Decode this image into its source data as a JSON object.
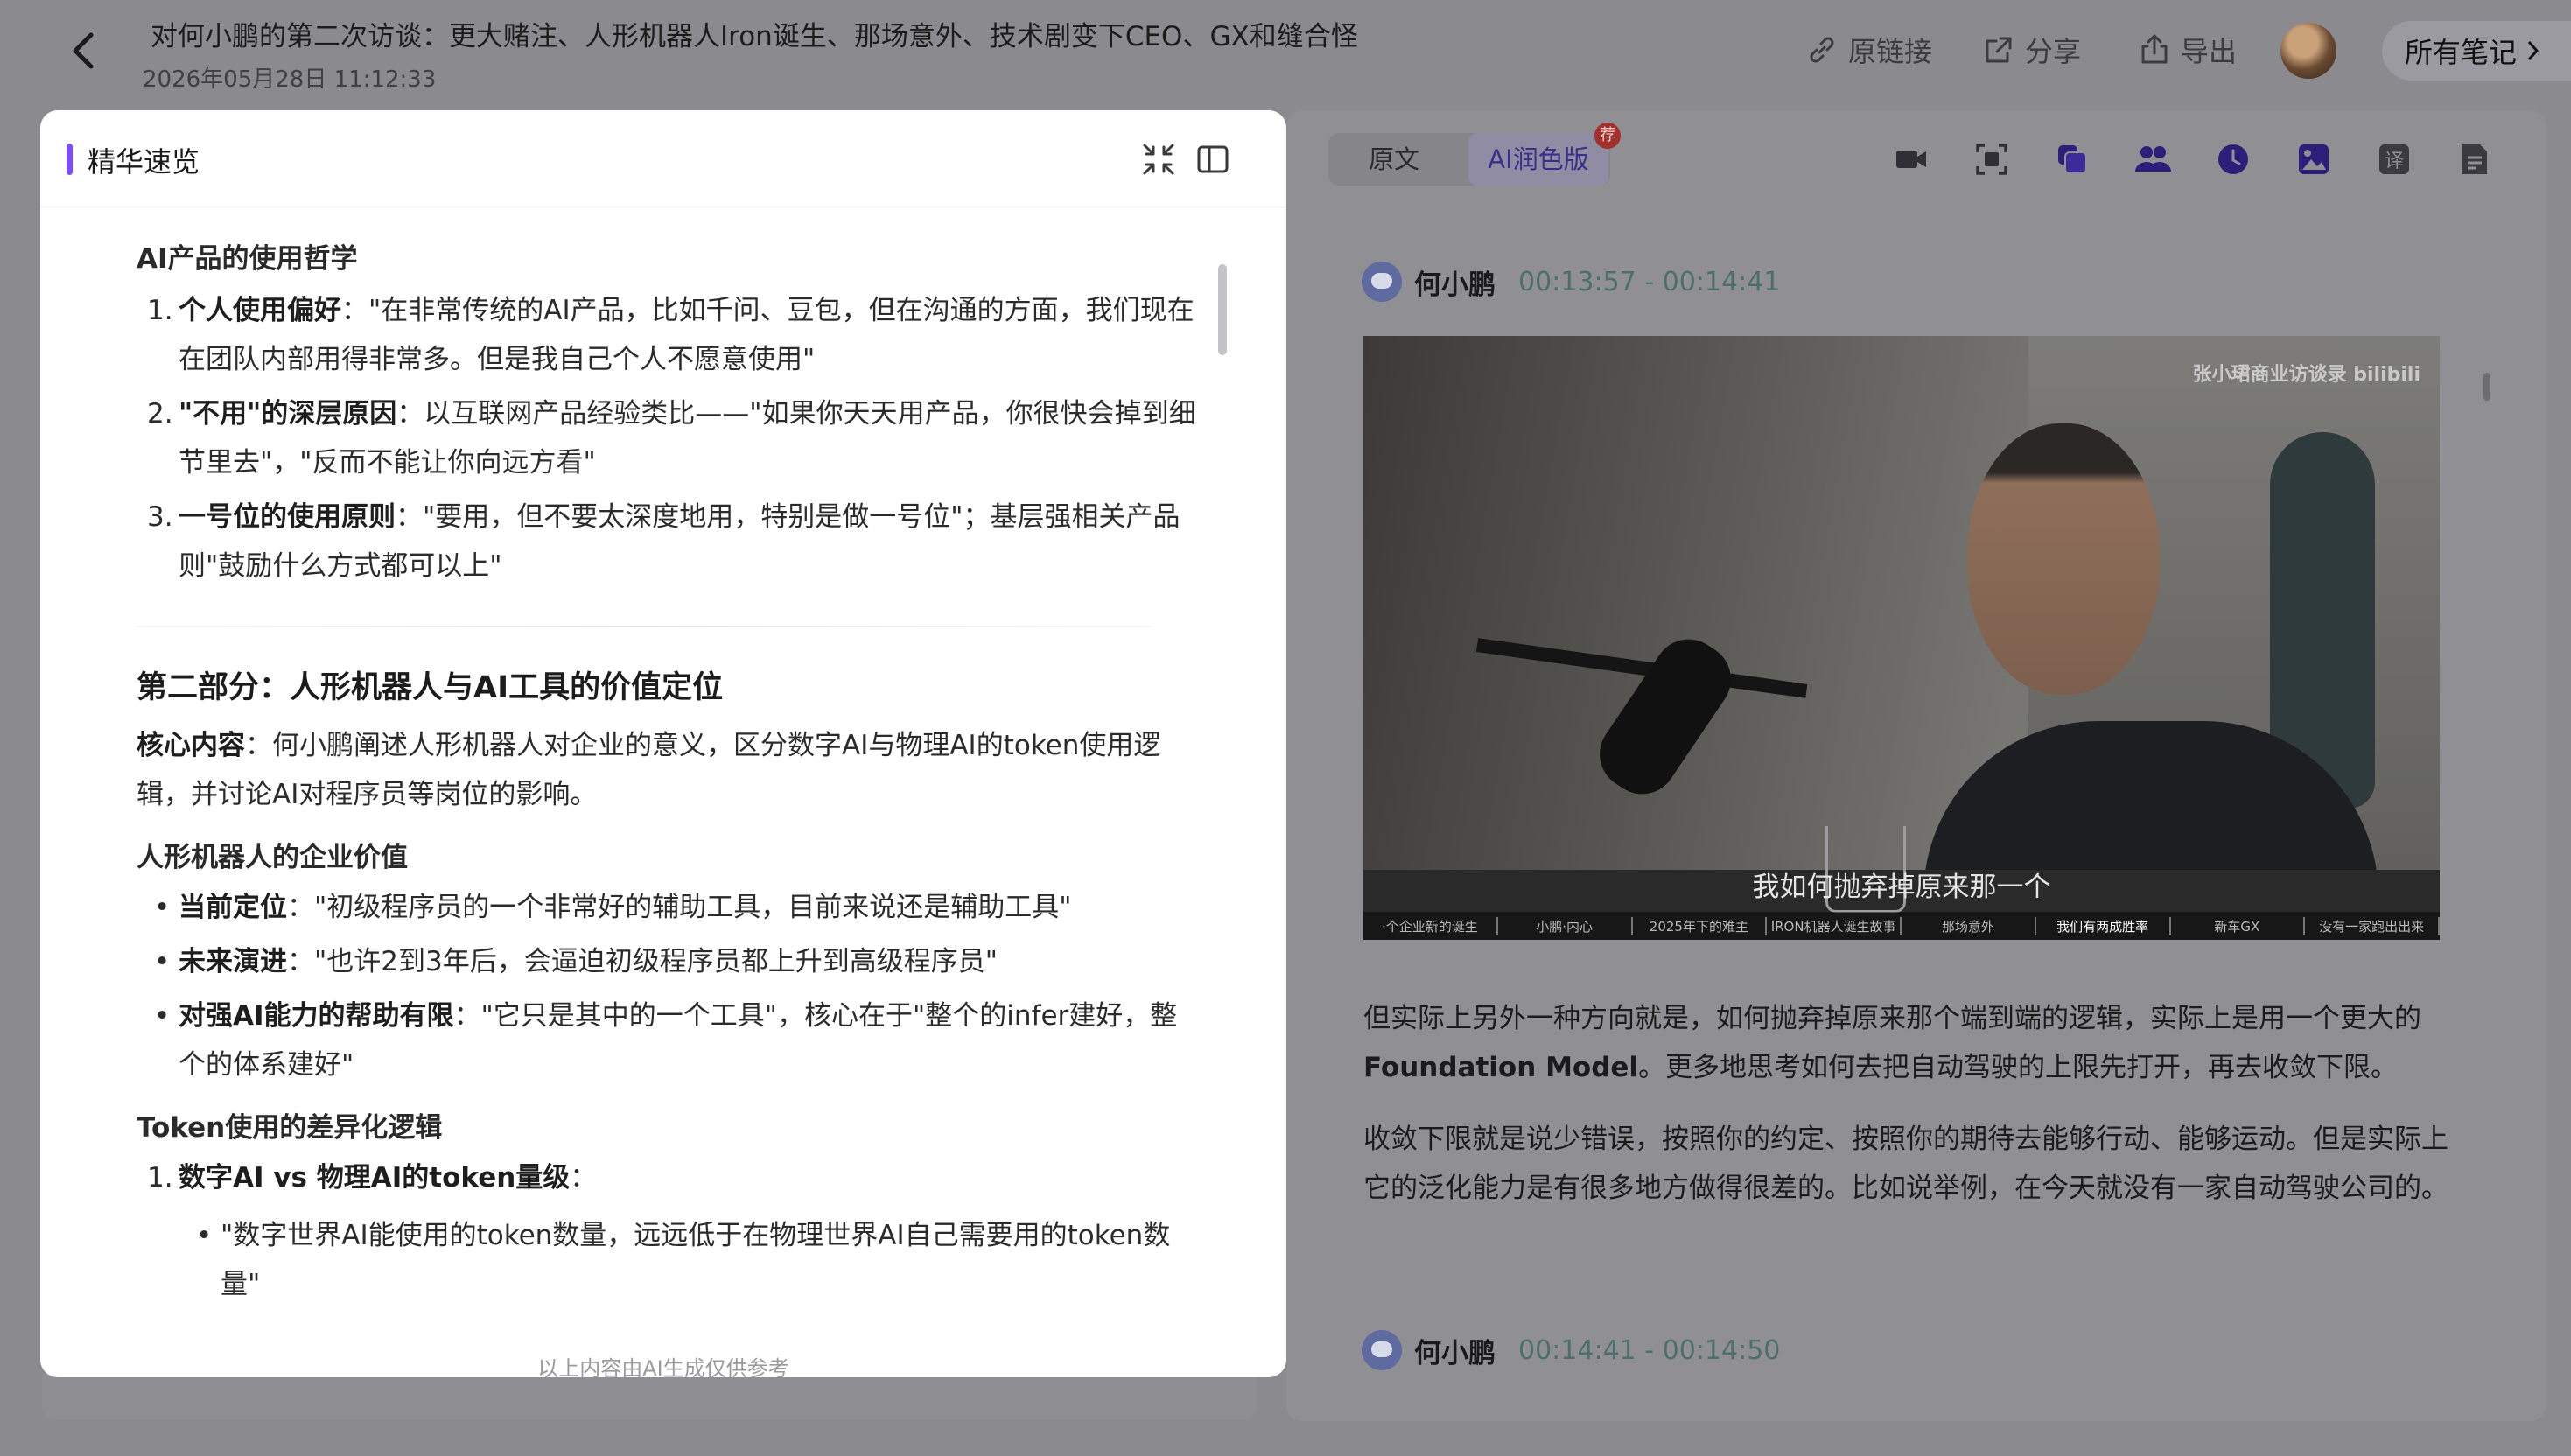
{
  "header": {
    "title": "对何小鹏的第二次访谈：更大赌注、人形机器人Iron诞生、那场意外、技术剧变下CEO、GX和缝合怪",
    "datetime": "2026年05月28日 11:12:33",
    "original_link_label": "原链接",
    "share_label": "分享",
    "export_label": "导出",
    "all_notes_label": "所有笔记"
  },
  "modal": {
    "title": "精华速览",
    "footer_note": "以上内容由AI生成仅供参考",
    "section1": {
      "heading": "AI产品的使用哲学",
      "items": [
        {
          "num": "1.",
          "label": "个人使用偏好",
          "text": "：\"在非常传统的AI产品，比如千问、豆包，但在沟通的方面，我们现在在团队内部用得非常多。但是我自己个人不愿意使用\""
        },
        {
          "num": "2.",
          "label": "\"不用\"的深层原因",
          "text": "：以互联网产品经验类比——\"如果你天天用产品，你很快会掉到细节里去\"，\"反而不能让你向远方看\""
        },
        {
          "num": "3.",
          "label": "一号位的使用原则",
          "text": "：\"要用，但不要太深度地用，特别是做一号位\"；基层强相关产品则\"鼓励什么方式都可以上\""
        }
      ]
    },
    "part2": {
      "heading": "第二部分：人形机器人与AI工具的价值定位",
      "core_label": "核心内容",
      "core_text": "：何小鹏阐述人形机器人对企业的意义，区分数字AI与物理AI的token使用逻辑，并讨论AI对程序员等岗位的影响。",
      "sub1": "人形机器人的企业价值",
      "bullets": [
        {
          "label": "当前定位",
          "text": "：\"初级程序员的一个非常好的辅助工具，目前来说还是辅助工具\""
        },
        {
          "label": "未来演进",
          "text": "：\"也许2到3年后，会逼迫初级程序员都上升到高级程序员\""
        },
        {
          "label": "对强AI能力的帮助有限",
          "text": "：\"它只是其中的一个工具\"，核心在于\"整个的infer建好，整个的体系建好\""
        }
      ],
      "sub2": "Token使用的差异化逻辑",
      "num_item": {
        "num": "1.",
        "label": "数字AI vs 物理AI的token量级",
        "text": "："
      },
      "nested_bullet": "\"数字世界AI能使用的token数量，远远低于在物理世界AI自己需要用的token数量\""
    }
  },
  "right": {
    "tab_original": "原文",
    "tab_ai": "AI润色版",
    "badge": "荐",
    "speaker1": {
      "name": "何小鹏",
      "time": "00:13:57 - 00:14:41"
    },
    "video": {
      "watermark": "张小珺商业访谈录 bilibili",
      "subtitle": "我如何抛弃掉原来那一个",
      "chapters": [
        "·个企业新的诞生",
        "小鹏·内心",
        "2025年下的难主",
        "IRON机器人诞生故事",
        "那场意外",
        "我们有两成胜率",
        "新车GX",
        "没有一家跑出出来"
      ],
      "active_chapter_index": 5
    },
    "para1_a": "但实际上另外一种方向就是，如何抛弃掉原来那个端到端的逻辑，实际上是用一个更大的 ",
    "para1_b": "Foundation Model",
    "para1_c": "。更多地思考如何去把自动驾驶的上限先打开，再去收敛下限。",
    "para2": "收敛下限就是说少错误，按照你的约定、按照你的期待去能够行动、能够运动。但是实际上它的泛化能力是有很多地方做得很差的。比如说举例，在今天就没有一家自动驾驶公司的。",
    "speaker2": {
      "name": "何小鹏",
      "time": "00:14:41 - 00:14:50"
    }
  },
  "colors": {
    "accent": "#7a4dff",
    "badge": "#e53935",
    "time_text": "#5a8f8a"
  },
  "icons": [
    "back-icon",
    "link-icon",
    "share-icon",
    "export-icon",
    "collapse-icon",
    "sidebar-icon",
    "video-icon",
    "screenshot-icon",
    "copy-icon",
    "speakers-icon",
    "clock-icon",
    "image-icon",
    "translate-icon",
    "document-icon"
  ]
}
